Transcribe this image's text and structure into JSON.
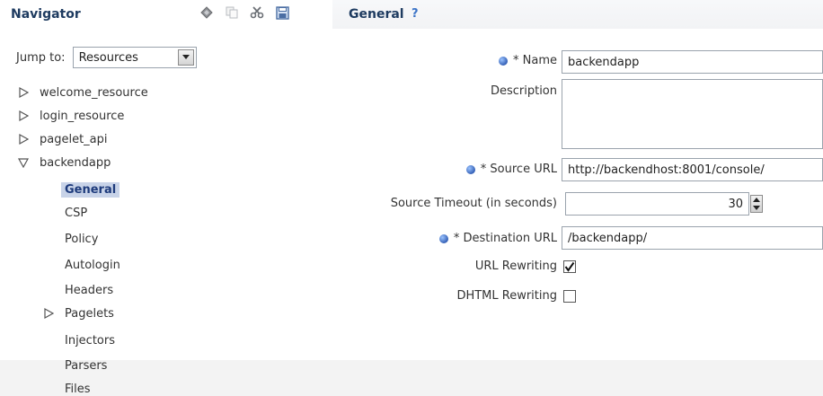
{
  "navigator": {
    "title": "Navigator",
    "tools": [
      "diamond-icon",
      "copy-icon",
      "cut-icon",
      "save-icon"
    ],
    "jump_to": {
      "label": "Jump to:",
      "value": "Resources"
    },
    "tree": [
      {
        "label": "welcome_resource",
        "expander": "collapsed"
      },
      {
        "label": "login_resource",
        "expander": "collapsed"
      },
      {
        "label": "pagelet_api",
        "expander": "collapsed"
      },
      {
        "label": "backendapp",
        "expander": "expanded"
      },
      {
        "label": "General",
        "selected": true
      },
      {
        "label": "CSP"
      },
      {
        "label": "Policy"
      },
      {
        "label": "Autologin"
      },
      {
        "label": "Headers"
      },
      {
        "label": "Pagelets",
        "expander": "collapsed"
      },
      {
        "label": "Injectors"
      },
      {
        "label": "Parsers"
      },
      {
        "label": "Files"
      }
    ]
  },
  "general": {
    "title": "General",
    "help": "?",
    "fields": {
      "name": {
        "label": "* Name",
        "value": "backendapp",
        "required": true
      },
      "description": {
        "label": "Description",
        "value": ""
      },
      "source_url": {
        "label": "* Source URL",
        "value": "http://backendhost:8001/console/",
        "required": true
      },
      "source_timeout": {
        "label": "Source Timeout (in seconds)",
        "value": "30"
      },
      "destination_url": {
        "label": "* Destination URL",
        "value": "/backendapp/",
        "required": true
      },
      "url_rewriting": {
        "label": "URL Rewriting",
        "checked": true
      },
      "dhtml_rewriting": {
        "label": "DHTML Rewriting",
        "checked": false
      }
    }
  },
  "colors": {
    "title_text": "#1e3b60",
    "selected_bg": "#c8d3e8",
    "required_dot": "#3460b6"
  }
}
